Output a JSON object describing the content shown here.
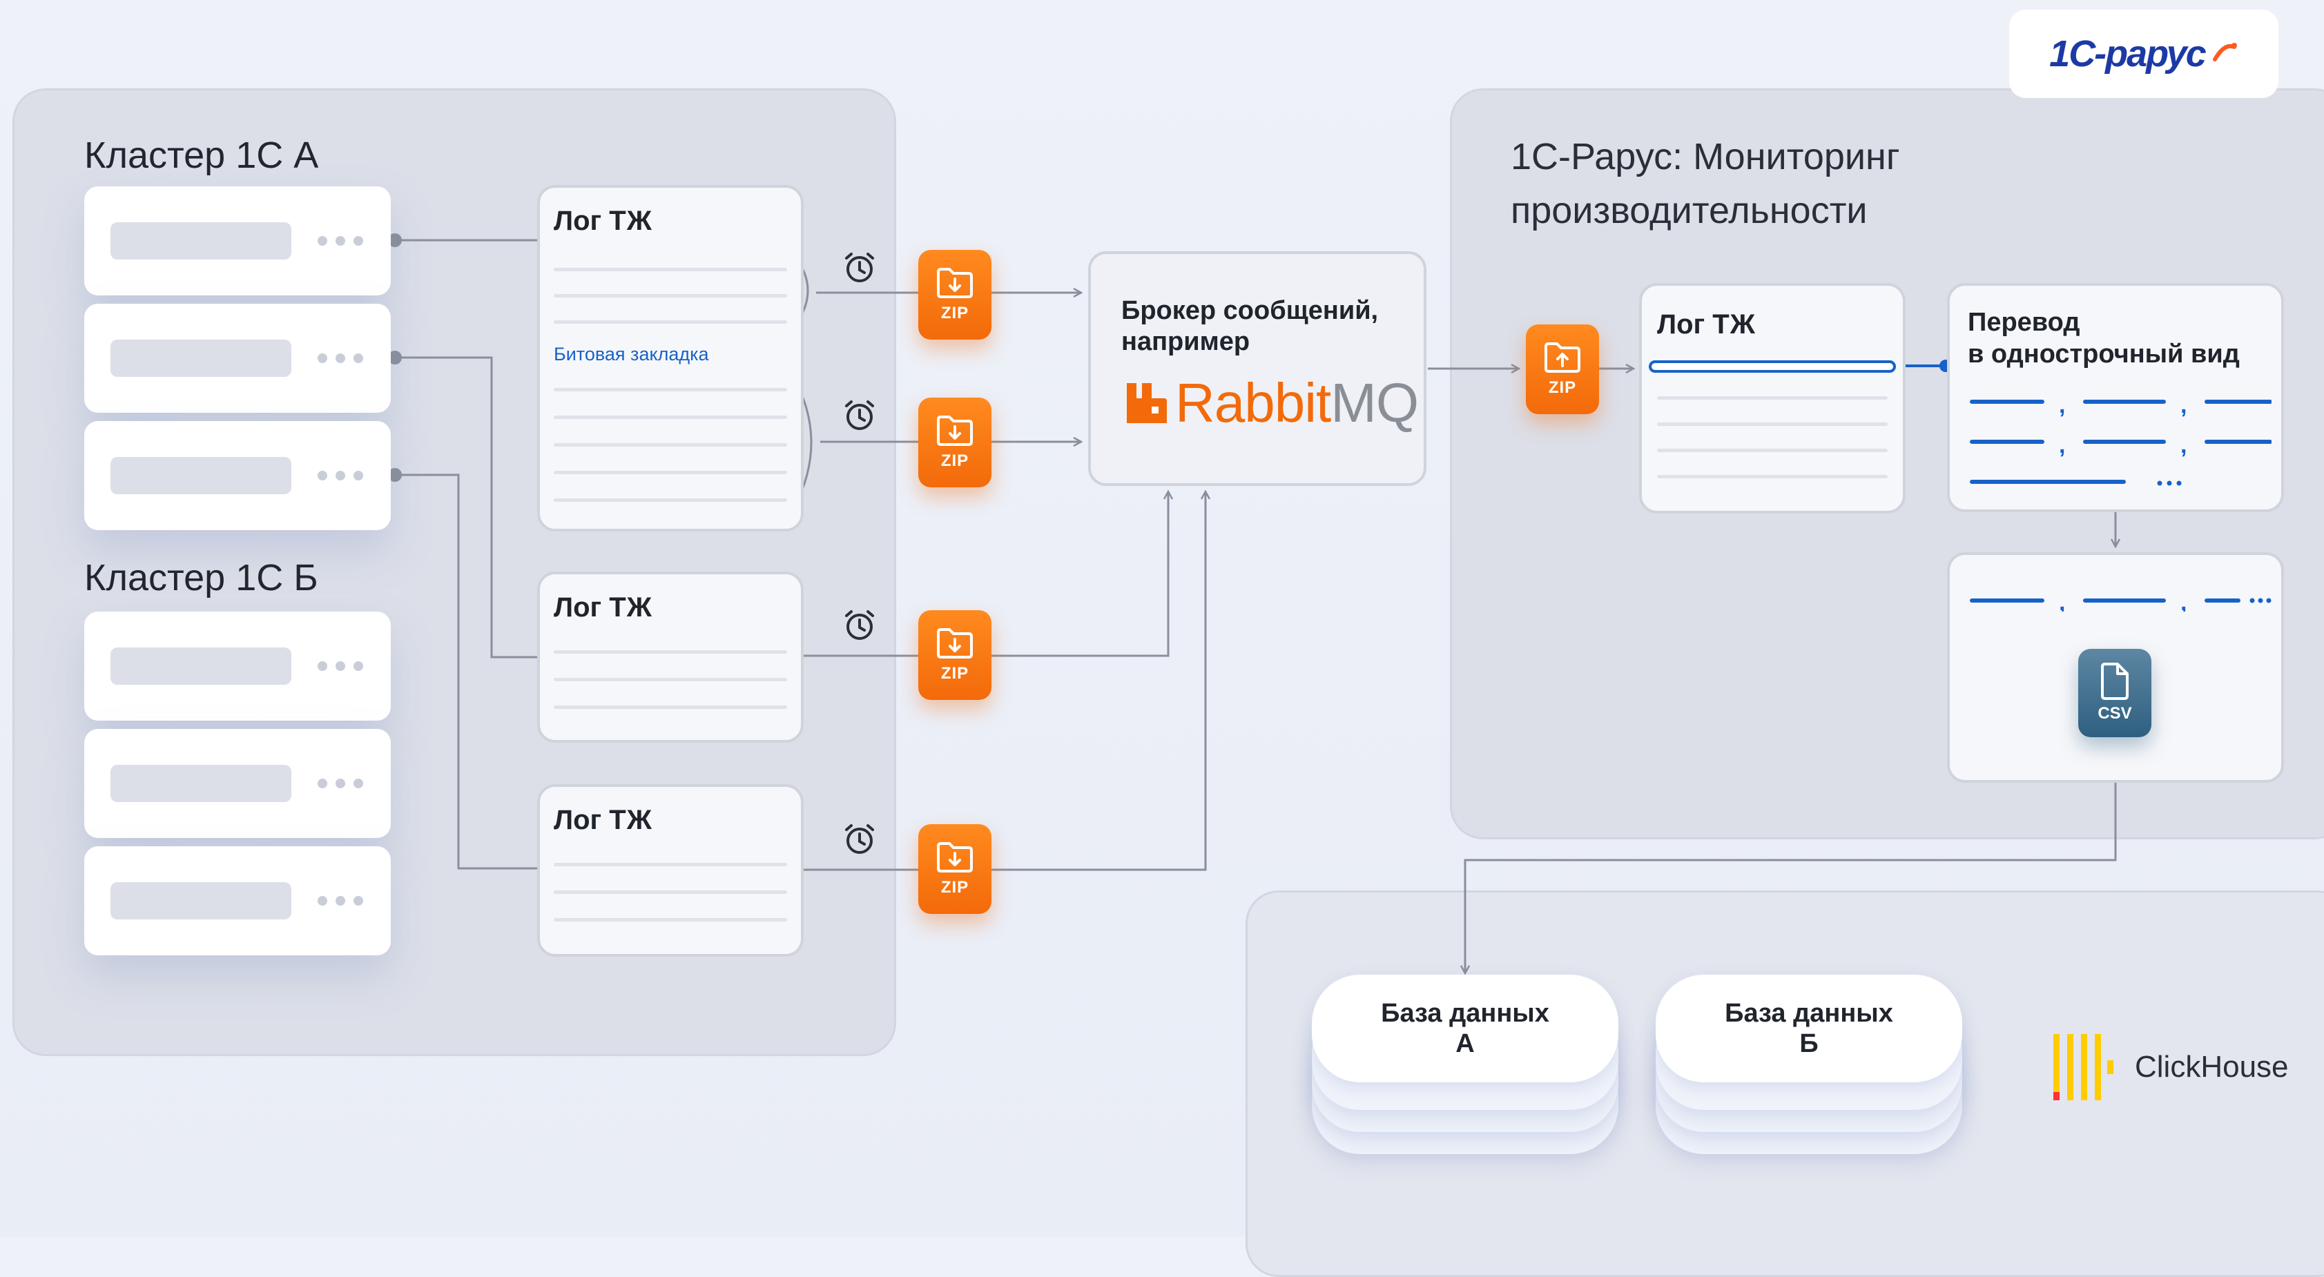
{
  "logo": {
    "text": "1С-рарус"
  },
  "cluster_a": {
    "title": "Кластер 1С А"
  },
  "cluster_b": {
    "title": "Кластер 1С Б"
  },
  "logs": {
    "log1": {
      "title": "Лог ТЖ",
      "bookmark": "Битовая закладка"
    },
    "log2": {
      "title": "Лог ТЖ"
    },
    "log3": {
      "title": "Лог ТЖ"
    },
    "log4": {
      "title": "Лог ТЖ"
    }
  },
  "zip_label": "ZIP",
  "broker": {
    "title_line1": "Брокер сообщений,",
    "title_line2": "например",
    "brand_a": "Rabbit",
    "brand_b": "MQ"
  },
  "monitoring": {
    "title_line1": "1С-Рарус: Мониторинг",
    "title_line2": "производительности",
    "log_title": "Лог ТЖ",
    "translate_line1": "Перевод",
    "translate_line2": "в однострочный вид",
    "ellipsis": "…",
    "csv_label": "CSV"
  },
  "databases": {
    "a_line1": "База данных",
    "a_line2": "А",
    "b_line1": "База данных",
    "b_line2": "Б"
  },
  "clickhouse": {
    "label": "ClickHouse"
  },
  "colors": {
    "orange": "#f36a0a",
    "blue": "#1762c8",
    "csv": "#2f5f80",
    "clickhouse_yellow": "#ffcc00",
    "clickhouse_red": "#ff3333"
  }
}
